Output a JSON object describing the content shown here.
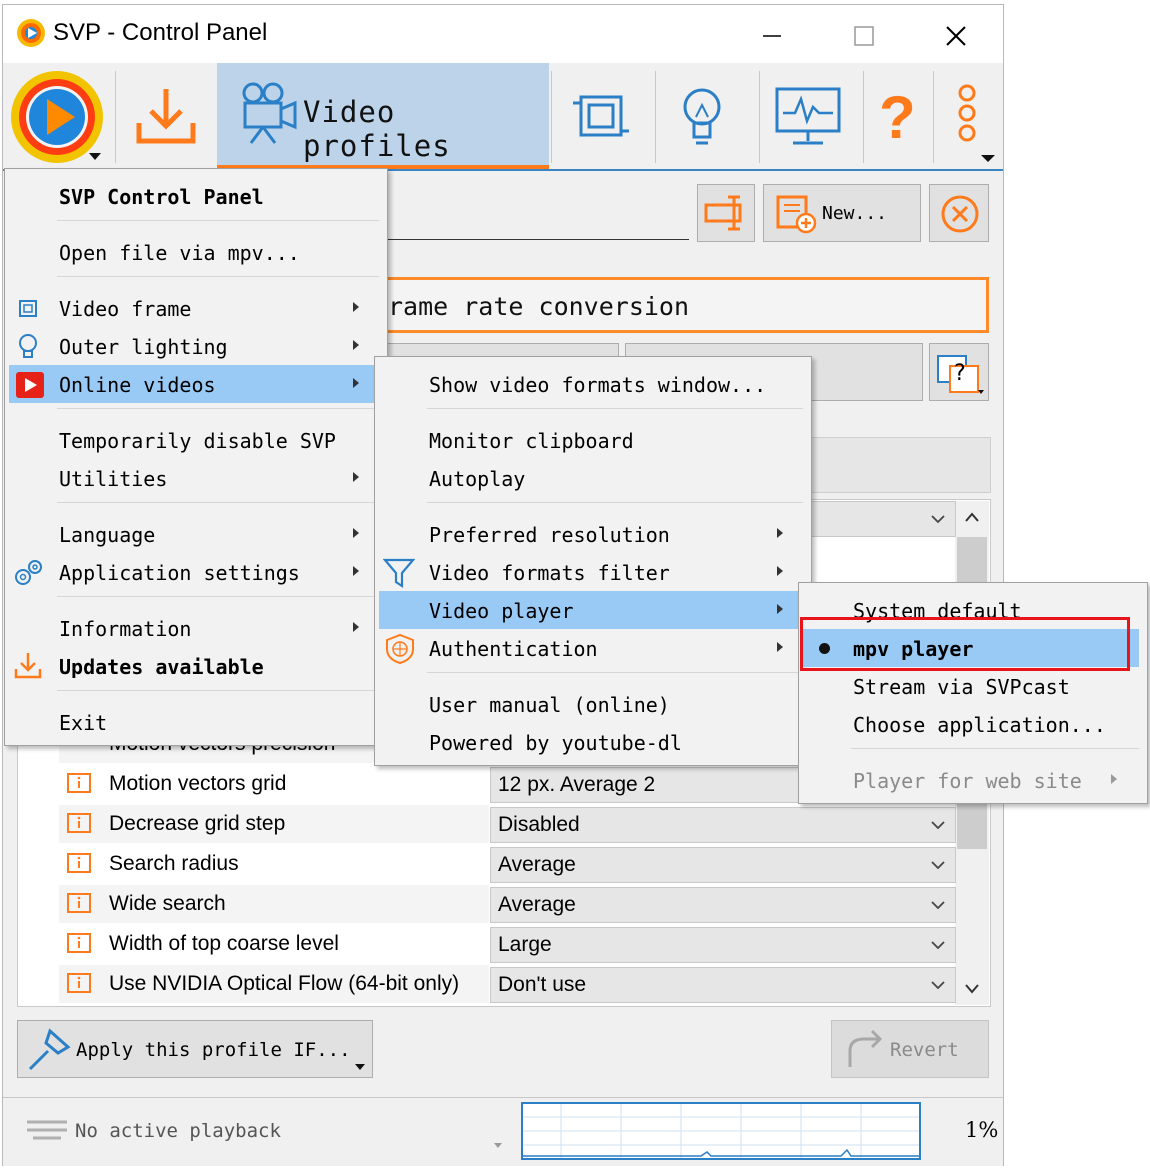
{
  "window": {
    "title": "SVP - Control Panel"
  },
  "toolbar": {
    "video_profiles_label": "Video profiles",
    "help_glyph": "?"
  },
  "profile": {
    "new_button": "New...",
    "heading_fragment": "rame rate conversion"
  },
  "params": [
    {
      "label": "Motion vectors precision",
      "value": ""
    },
    {
      "label": "Motion vectors grid",
      "value": "12 px. Average 2"
    },
    {
      "label": "Decrease grid step",
      "value": "Disabled"
    },
    {
      "label": "Search radius",
      "value": "Average"
    },
    {
      "label": "Wide search",
      "value": "Average"
    },
    {
      "label": "Width of top coarse level",
      "value": "Large"
    },
    {
      "label": "Use NVIDIA Optical Flow (64-bit only)",
      "value": "Don't use"
    }
  ],
  "bottom": {
    "apply_label": "Apply this profile IF...",
    "revert_label": "Revert"
  },
  "status": {
    "playback": "No active playback",
    "cpu": "1%"
  },
  "main_menu": {
    "header": "SVP Control Panel",
    "open_file": "Open file via mpv...",
    "video_frame": "Video frame",
    "outer_lighting": "Outer lighting",
    "online_videos": "Online videos",
    "disable": "Temporarily disable SVP",
    "utilities": "Utilities",
    "language": "Language",
    "app_settings": "Application settings",
    "information": "Information",
    "updates": "Updates available",
    "exit": "Exit"
  },
  "online_menu": {
    "show_formats": "Show video formats window...",
    "monitor_clipboard": "Monitor clipboard",
    "autoplay": "Autoplay",
    "preferred_resolution": "Preferred resolution",
    "formats_filter": "Video formats filter",
    "video_player": "Video player",
    "authentication": "Authentication",
    "user_manual": "User manual (online)",
    "powered_by": "Powered by youtube-dl"
  },
  "player_menu": {
    "system_default": "System default",
    "mpv_player": "mpv player",
    "stream": "Stream via SVPcast",
    "choose_app": "Choose application...",
    "web_site": "Player for web site"
  },
  "colors": {
    "accent_orange": "#ff7a1a",
    "highlight_blue": "#99c9f5",
    "selection_box": "#e8141c"
  }
}
